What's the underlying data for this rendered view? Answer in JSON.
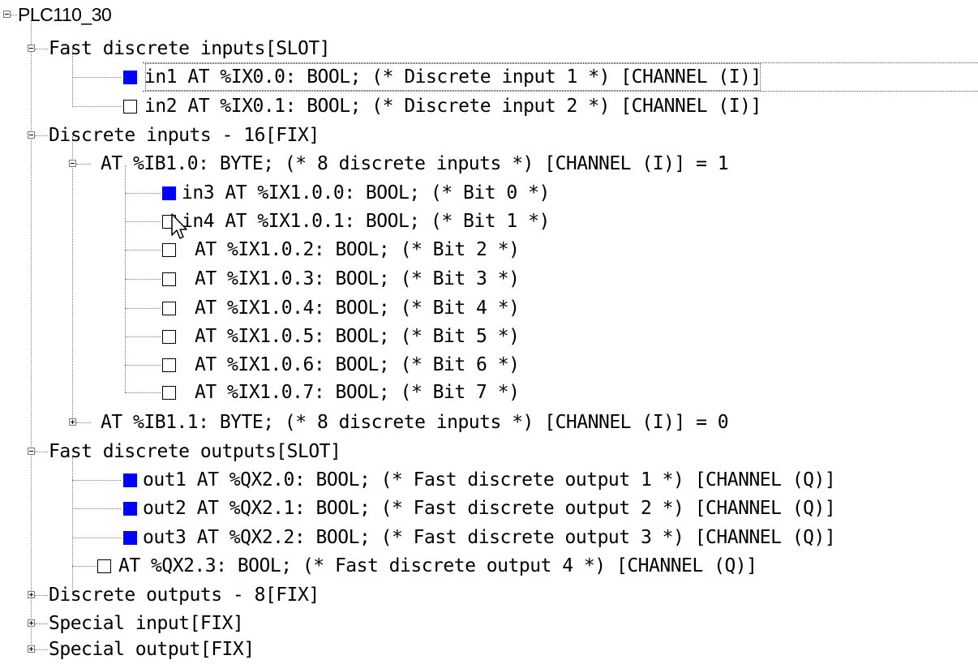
{
  "tree": {
    "root": {
      "label": "PLC110_30",
      "expanded": true
    },
    "fast_inputs": {
      "label": "Fast discrete inputs[SLOT]",
      "expanded": true,
      "items": [
        {
          "label": "in1 AT %IX0.0: BOOL; (* Discrete input 1 *) [CHANNEL (I)]",
          "checked": true,
          "selected": true
        },
        {
          "label": "in2 AT %IX0.1: BOOL; (* Discrete input 2 *) [CHANNEL (I)]",
          "checked": false
        }
      ]
    },
    "discrete_inputs": {
      "label": "Discrete inputs - 16[FIX]",
      "expanded": true,
      "byte0": {
        "label": "AT %IB1.0: BYTE; (* 8 discrete inputs *) [CHANNEL (I)] = 1",
        "expanded": true,
        "bits": [
          {
            "label": "in3 AT %IX1.0.0: BOOL; (* Bit 0 *)",
            "checked": true
          },
          {
            "label": "in4 AT %IX1.0.1: BOOL; (* Bit 1 *)",
            "checked": false
          },
          {
            "label": "AT %IX1.0.2: BOOL; (* Bit 2 *)",
            "checked": false
          },
          {
            "label": "AT %IX1.0.3: BOOL; (* Bit 3 *)",
            "checked": false
          },
          {
            "label": "AT %IX1.0.4: BOOL; (* Bit 4 *)",
            "checked": false
          },
          {
            "label": "AT %IX1.0.5: BOOL; (* Bit 5 *)",
            "checked": false
          },
          {
            "label": "AT %IX1.0.6: BOOL; (* Bit 6 *)",
            "checked": false
          },
          {
            "label": "AT %IX1.0.7: BOOL; (* Bit 7 *)",
            "checked": false
          }
        ]
      },
      "byte1": {
        "label": "AT %IB1.1: BYTE; (* 8 discrete inputs *) [CHANNEL (I)] = 0",
        "expanded": false
      }
    },
    "fast_outputs": {
      "label": "Fast discrete outputs[SLOT]",
      "expanded": true,
      "items": [
        {
          "label": "out1 AT %QX2.0: BOOL; (* Fast discrete output 1 *) [CHANNEL (Q)]",
          "checked": true
        },
        {
          "label": "out2 AT %QX2.1: BOOL; (* Fast discrete output 2 *) [CHANNEL (Q)]",
          "checked": true
        },
        {
          "label": "out3 AT %QX2.2: BOOL; (* Fast discrete output 3 *) [CHANNEL (Q)]",
          "checked": true
        },
        {
          "label": "AT %QX2.3: BOOL; (* Fast discrete output 4 *) [CHANNEL (Q)]",
          "checked": false
        }
      ]
    },
    "discrete_outputs": {
      "label": "Discrete outputs - 8[FIX]",
      "expanded": false
    },
    "special_input": {
      "label": "Special input[FIX]",
      "expanded": false
    },
    "special_output": {
      "label": "Special output[FIX]",
      "expanded": false
    }
  },
  "colors": {
    "checked_fill": "#0000ff",
    "tree_line": "#7a7a7a",
    "background": "#ffffff"
  },
  "icons": {
    "expanded": "minus-box-icon",
    "collapsed": "plus-box-icon",
    "cursor": "mouse-pointer-icon"
  }
}
